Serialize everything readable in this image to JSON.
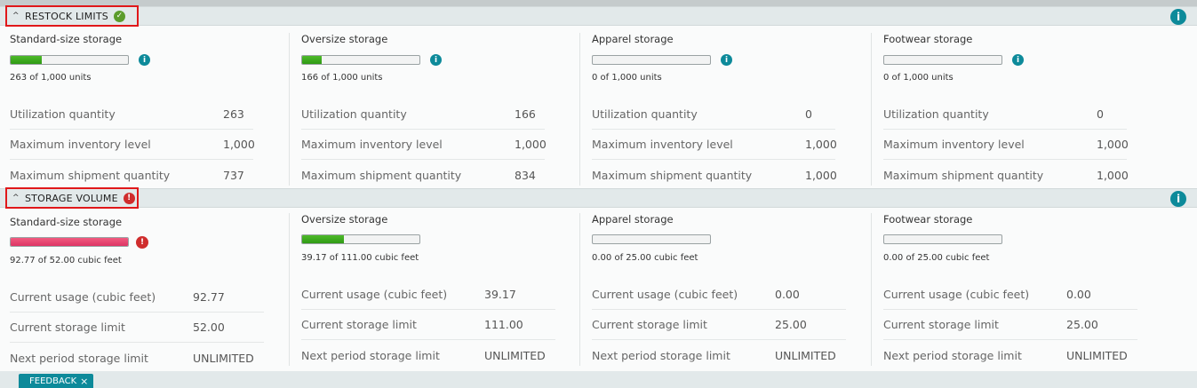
{
  "restock": {
    "title": "RESTOCK LIMITS",
    "status": "ok",
    "panels": [
      {
        "name": "Standard-size storage",
        "fraction": 0.263,
        "usage": "263 of 1,000 units",
        "rows": [
          {
            "label": "Utilization quantity",
            "value": "263"
          },
          {
            "label": "Maximum inventory level",
            "value": "1,000"
          },
          {
            "label": "Maximum shipment quantity",
            "value": "737"
          }
        ]
      },
      {
        "name": "Oversize storage",
        "fraction": 0.166,
        "usage": "166 of 1,000 units",
        "rows": [
          {
            "label": "Utilization quantity",
            "value": "166"
          },
          {
            "label": "Maximum inventory level",
            "value": "1,000"
          },
          {
            "label": "Maximum shipment quantity",
            "value": "834"
          }
        ]
      },
      {
        "name": "Apparel storage",
        "fraction": 0,
        "usage": "0 of 1,000 units",
        "rows": [
          {
            "label": "Utilization quantity",
            "value": "0"
          },
          {
            "label": "Maximum inventory level",
            "value": "1,000"
          },
          {
            "label": "Maximum shipment quantity",
            "value": "1,000"
          }
        ]
      },
      {
        "name": "Footwear storage",
        "fraction": 0,
        "usage": "0 of 1,000 units",
        "rows": [
          {
            "label": "Utilization quantity",
            "value": "0"
          },
          {
            "label": "Maximum inventory level",
            "value": "1,000"
          },
          {
            "label": "Maximum shipment quantity",
            "value": "1,000"
          }
        ]
      }
    ]
  },
  "storage": {
    "title": "STORAGE VOLUME",
    "status": "warning",
    "panels": [
      {
        "name": "Standard-size storage",
        "fraction": 1.0,
        "over_limit": true,
        "usage": "92.77 of 52.00 cubic feet",
        "rows": [
          {
            "label": "Current usage (cubic feet)",
            "value": "92.77"
          },
          {
            "label": "Current storage limit",
            "value": "52.00"
          },
          {
            "label": "Next period storage limit",
            "value": "UNLIMITED"
          }
        ]
      },
      {
        "name": "Oversize storage",
        "fraction": 0.353,
        "usage": "39.17 of 111.00 cubic feet",
        "rows": [
          {
            "label": "Current usage (cubic feet)",
            "value": "39.17"
          },
          {
            "label": "Current storage limit",
            "value": "111.00"
          },
          {
            "label": "Next period storage limit",
            "value": "UNLIMITED"
          }
        ]
      },
      {
        "name": "Apparel storage",
        "fraction": 0,
        "usage": "0.00 of 25.00 cubic feet",
        "rows": [
          {
            "label": "Current usage (cubic feet)",
            "value": "0.00"
          },
          {
            "label": "Current storage limit",
            "value": "25.00"
          },
          {
            "label": "Next period storage limit",
            "value": "UNLIMITED"
          }
        ]
      },
      {
        "name": "Footwear storage",
        "fraction": 0,
        "usage": "0.00 of 25.00 cubic feet",
        "rows": [
          {
            "label": "Current usage (cubic feet)",
            "value": "0.00"
          },
          {
            "label": "Current storage limit",
            "value": "25.00"
          },
          {
            "label": "Next period storage limit",
            "value": "UNLIMITED"
          }
        ]
      }
    ]
  },
  "feedback": {
    "label": "FEEDBACK",
    "close": "×"
  },
  "icons": {
    "info": "i",
    "ok": "✓",
    "warn": "!",
    "chevron": "^"
  },
  "colors": {
    "accent": "#0d8a9a",
    "ok": "#5c9c2c",
    "warning": "#cf2d2d",
    "bar_fill": "#3aa81c",
    "bar_over": "#e2416f"
  }
}
